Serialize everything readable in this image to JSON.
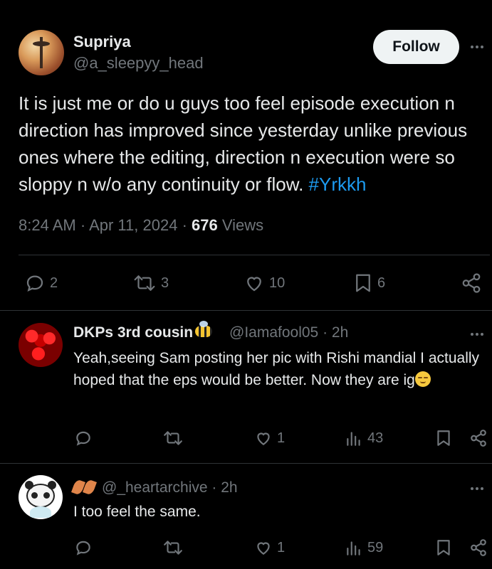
{
  "main_post": {
    "author": {
      "name": "Supriya",
      "handle": "@a_sleepyy_head"
    },
    "follow_label": "Follow",
    "text": "It is just me or do u guys too feel episode execution n direction has improved since yesterday unlike previous ones where the editing, direction n execution were so sloppy n w/o any continuity or flow. ",
    "hashtag": "#Yrkkh",
    "time": "8:24 AM",
    "date": "Apr 11, 2024",
    "views_count": "676",
    "views_label": "Views",
    "stats": {
      "replies": "2",
      "reposts": "3",
      "likes": "10",
      "bookmarks": "6"
    }
  },
  "replies": [
    {
      "name": "DKPs 3rd cousin",
      "handle": "@Iamafool05",
      "time": "2h",
      "text": "Yeah,seeing Sam posting her pic with Rishi mandial I actually hoped that the eps would be better. Now they are ig",
      "stats": {
        "replies": "",
        "reposts": "",
        "likes": "1",
        "views": "43"
      }
    },
    {
      "name": "",
      "handle": "@_heartarchive",
      "time": "2h",
      "text": "I too feel the same.",
      "stats": {
        "replies": "",
        "reposts": "",
        "likes": "1",
        "views": "59"
      }
    }
  ],
  "colors": {
    "background": "#000000",
    "text": "#e7e9ea",
    "muted": "#71767b",
    "link": "#1d9bf0",
    "divider": "#2f3336"
  },
  "icons": [
    "reply-icon",
    "repost-icon",
    "like-icon",
    "bookmark-icon",
    "share-icon",
    "views-icon",
    "more-icon"
  ]
}
